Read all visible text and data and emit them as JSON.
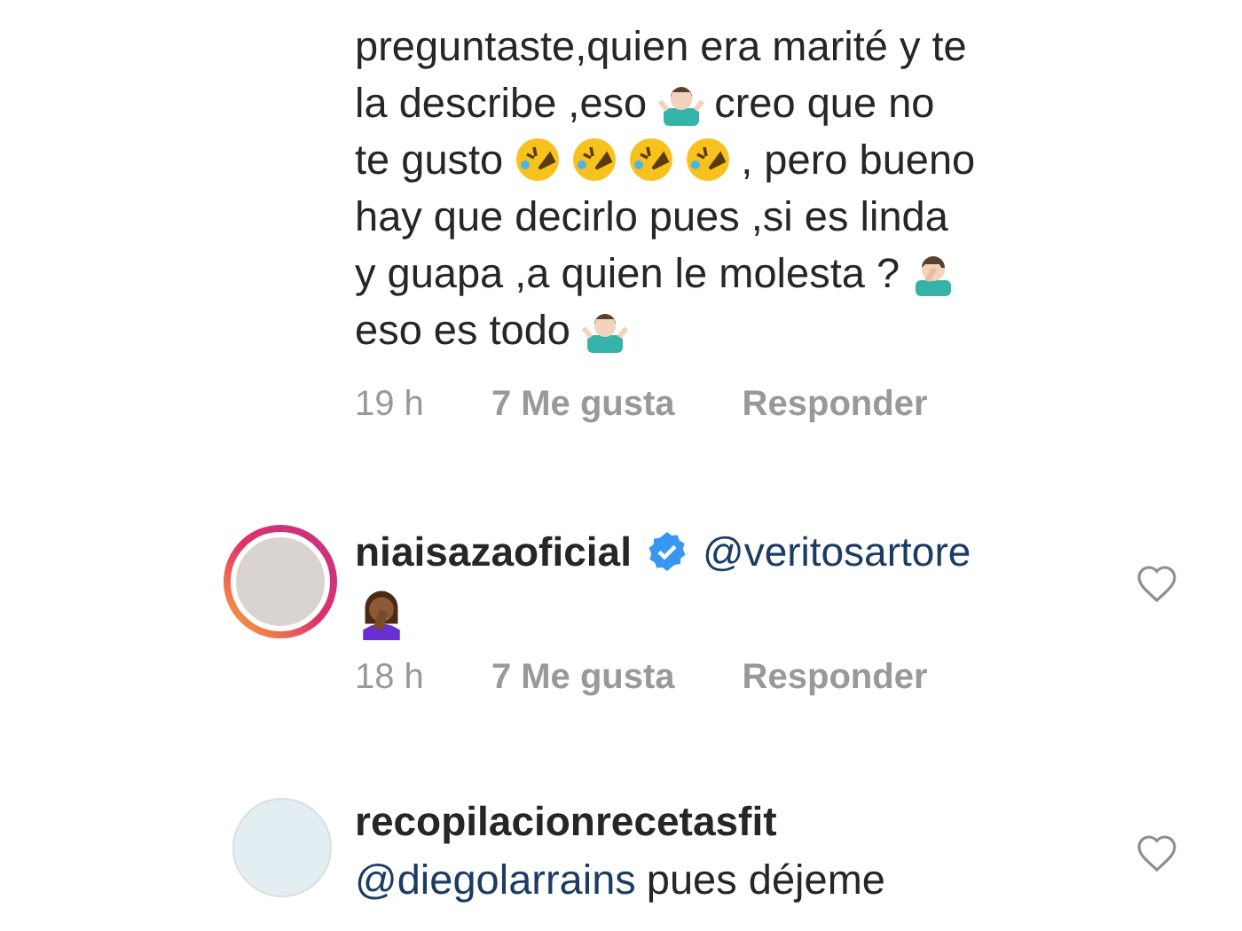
{
  "comments": [
    {
      "avatar": false,
      "lines": [
        [
          {
            "kind": "text",
            "text": "preguntaste,quien era marité y te"
          }
        ],
        [
          {
            "kind": "text",
            "text": "la describe ,eso"
          },
          {
            "kind": "shrug"
          },
          {
            "kind": "text",
            "text": "creo que no"
          }
        ],
        [
          {
            "kind": "text",
            "text": "te gusto"
          },
          {
            "kind": "rofl"
          },
          {
            "kind": "rofl"
          },
          {
            "kind": "rofl"
          },
          {
            "kind": "rofl"
          },
          {
            "kind": "text",
            "text": ", pero bueno"
          }
        ],
        [
          {
            "kind": "text",
            "text": "hay que decirlo pues ,si es linda"
          }
        ],
        [
          {
            "kind": "text",
            "text": "y guapa ,a quien le molesta ?"
          },
          {
            "kind": "facepalm"
          }
        ],
        [
          {
            "kind": "text",
            "text": "eso es todo"
          },
          {
            "kind": "shrug"
          }
        ]
      ],
      "time": "19 h",
      "likes": "7 Me gusta",
      "reply": "Responder"
    },
    {
      "avatar": true,
      "story_ring": true,
      "username": "niaisazaoficial",
      "verified": true,
      "mention": "@veritosartore",
      "liked": false,
      "lines": [
        [
          {
            "kind": "womanfacepalm"
          }
        ]
      ],
      "time": "18 h",
      "likes": "7 Me gusta",
      "reply": "Responder"
    },
    {
      "avatar": true,
      "story_ring": false,
      "username": "recopilacionrecetasfit",
      "verified": false,
      "liked": false,
      "lines": [
        [
          {
            "kind": "mention",
            "text": "@diegolarrains"
          },
          {
            "kind": "text",
            "text": "pues déjeme"
          }
        ]
      ]
    }
  ]
}
